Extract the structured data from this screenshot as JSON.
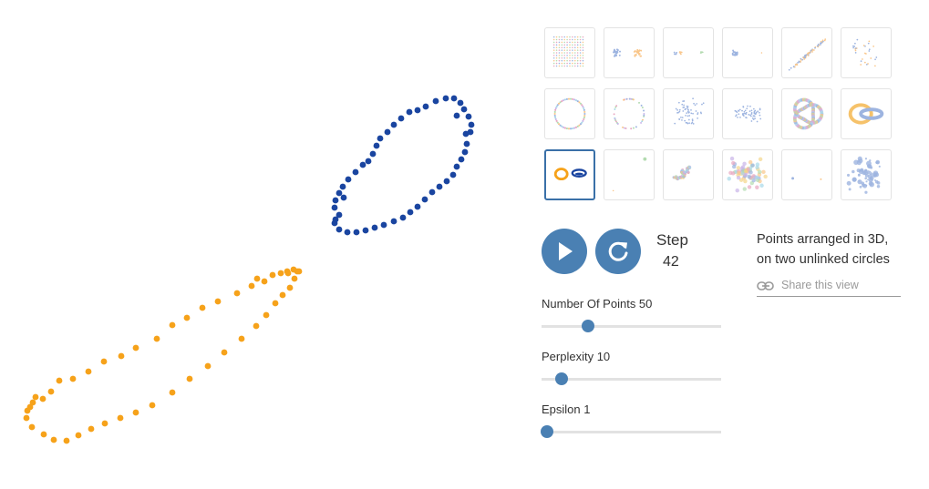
{
  "colors": {
    "orange": "#f6a21a",
    "blue": "#1a45a0",
    "accent": "#4a80b3",
    "thumb_border": "#e3e3e3"
  },
  "thumbnails": [
    {
      "icon": "grid-dataset-icon"
    },
    {
      "icon": "two-clusters-icon"
    },
    {
      "icon": "three-clusters-icon"
    },
    {
      "icon": "two-different-clusters-icon"
    },
    {
      "icon": "two-long-lines-icon"
    },
    {
      "icon": "cluster-in-cluster-icon"
    },
    {
      "icon": "circle-evenly-spaced-icon"
    },
    {
      "icon": "circle-randomly-spaced-icon"
    },
    {
      "icon": "gaussian-cloud-icon"
    },
    {
      "icon": "ellipsoidal-cloud-icon"
    },
    {
      "icon": "trefoil-knot-icon"
    },
    {
      "icon": "linked-rings-icon"
    },
    {
      "icon": "unlinked-rings-icon",
      "selected": true
    },
    {
      "icon": "orthogonal-steps-icon"
    },
    {
      "icon": "random-walk-icon"
    },
    {
      "icon": "random-jump-icon"
    },
    {
      "icon": "simplex-corners-icon"
    },
    {
      "icon": "uneven-cluster-icon"
    }
  ],
  "controls": {
    "play_icon": "play-icon",
    "reset_icon": "refresh-icon",
    "step_label": "Step",
    "step_value": "42"
  },
  "description": {
    "line1": "Points arranged in 3D,",
    "line2": "on two unlinked circles",
    "share_label": "Share this view",
    "share_icon": "link-icon"
  },
  "params": [
    {
      "label": "Number Of Points 50",
      "fraction": 0.26
    },
    {
      "label": "Perplexity 10",
      "fraction": 0.11
    },
    {
      "label": "Epsilon 1",
      "fraction": 0.03
    }
  ]
}
